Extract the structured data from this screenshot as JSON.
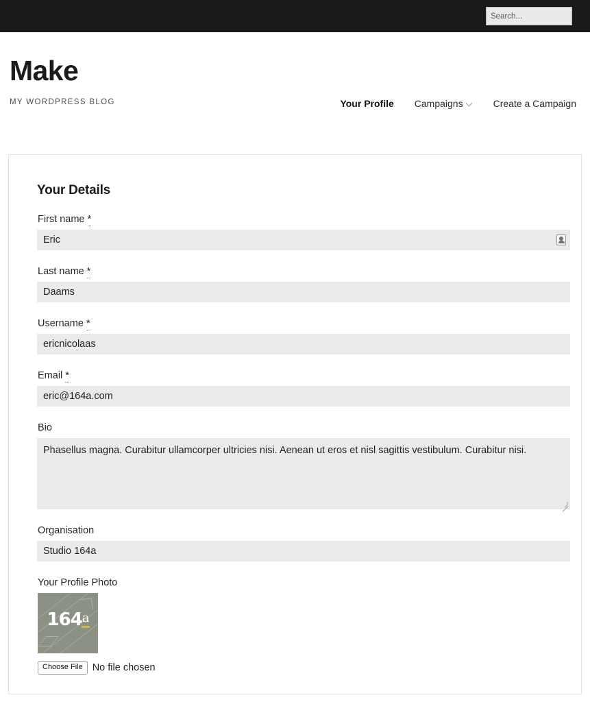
{
  "topbar": {
    "search": {
      "placeholder": "Search...",
      "value": ""
    }
  },
  "site": {
    "title": "Make",
    "description": "MY WORDPRESS BLOG"
  },
  "nav": {
    "items": [
      {
        "label": "Your Profile",
        "current": true,
        "has_dropdown": false
      },
      {
        "label": "Campaigns",
        "current": false,
        "has_dropdown": true
      },
      {
        "label": "Create a Campaign",
        "current": false,
        "has_dropdown": false
      }
    ]
  },
  "form": {
    "heading": "Your Details",
    "required_marker": "*",
    "fields": {
      "first_name": {
        "label": "First name",
        "value": "Eric",
        "required": true
      },
      "last_name": {
        "label": "Last name",
        "value": "Daams",
        "required": true
      },
      "username": {
        "label": "Username",
        "value": "ericnicolaas",
        "required": true
      },
      "email": {
        "label": "Email",
        "value": "eric@164a.com",
        "required": true
      },
      "bio": {
        "label": "Bio",
        "value": "Phasellus magna. Curabitur ullamcorper ultricies nisi. Aenean ut eros et nisl sagittis vestibulum. Curabitur nisi.",
        "required": false
      },
      "organisation": {
        "label": "Organisation",
        "value": "Studio 164a",
        "required": false
      },
      "profile_photo": {
        "label": "Your Profile Photo",
        "avatar_text": "164",
        "avatar_suffix": "a",
        "choose_label": "Choose File",
        "status": "No file chosen"
      }
    }
  },
  "colors": {
    "topbar_bg": "#1a1a1a",
    "input_bg": "#eaeaea",
    "card_border": "#e4e4e4",
    "avatar_bg": "#8b9183",
    "avatar_accent": "#d8b64a"
  }
}
